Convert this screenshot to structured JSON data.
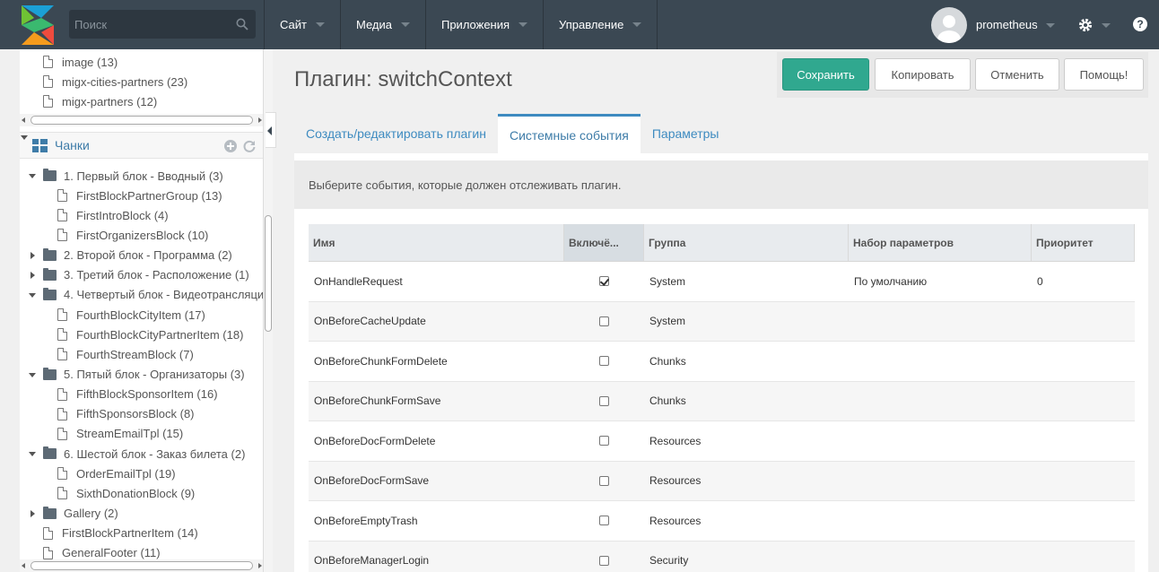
{
  "topbar": {
    "search_placeholder": "Поиск",
    "menu": [
      "Сайт",
      "Медиа",
      "Приложения",
      "Управление"
    ],
    "username": "prometheus",
    "help_label": "?"
  },
  "tree": {
    "top_files": [
      {
        "name": "image",
        "count": "(13)"
      },
      {
        "name": "migx-cities-partners",
        "count": "(23)"
      },
      {
        "name": "migx-partners",
        "count": "(12)"
      }
    ],
    "section_title": "Чанки",
    "items": [
      {
        "type": "folder",
        "open": true,
        "name": "1. Первый блок - Вводный",
        "count": "(3)"
      },
      {
        "type": "file",
        "name": "FirstBlockPartnerGroup",
        "count": "(13)"
      },
      {
        "type": "file",
        "name": "FirstIntroBlock",
        "count": "(4)"
      },
      {
        "type": "file",
        "name": "FirstOrganizersBlock",
        "count": "(10)"
      },
      {
        "type": "folder",
        "open": false,
        "name": "2. Второй блок - Программа",
        "count": "(2)"
      },
      {
        "type": "folder",
        "open": false,
        "name": "3. Третий блок - Расположение",
        "count": "(1)"
      },
      {
        "type": "folder",
        "open": true,
        "name": "4. Четвертый блок - Видеотрансляци",
        "count": ""
      },
      {
        "type": "file",
        "name": "FourthBlockCityItem",
        "count": "(17)"
      },
      {
        "type": "file",
        "name": "FourthBlockCityPartnerItem",
        "count": "(18)"
      },
      {
        "type": "file",
        "name": "FourthStreamBlock",
        "count": "(7)"
      },
      {
        "type": "folder",
        "open": true,
        "name": "5. Пятый блок - Организаторы",
        "count": "(3)"
      },
      {
        "type": "file",
        "name": "FifthBlockSponsorItem",
        "count": "(16)"
      },
      {
        "type": "file",
        "name": "FifthSponsorsBlock",
        "count": "(8)"
      },
      {
        "type": "file",
        "name": "StreamEmailTpl",
        "count": "(15)"
      },
      {
        "type": "folder",
        "open": true,
        "name": "6. Шестой блок - Заказ билета",
        "count": "(2)"
      },
      {
        "type": "file",
        "name": "OrderEmailTpl",
        "count": "(19)"
      },
      {
        "type": "file",
        "name": "SixthDonationBlock",
        "count": "(9)"
      },
      {
        "type": "folder",
        "open": false,
        "name": "Gallery",
        "count": "(2)"
      },
      {
        "type": "rootfile",
        "name": "FirstBlockPartnerItem",
        "count": "(14)"
      },
      {
        "type": "rootfile",
        "name": "GeneralFooter",
        "count": "(11)"
      }
    ]
  },
  "page": {
    "title": "Плагин: switchContext",
    "buttons": {
      "save": "Сохранить",
      "copy": "Копировать",
      "cancel": "Отменить",
      "help": "Помощь!"
    },
    "tabs": [
      "Создать/редактировать плагин",
      "Системные события",
      "Параметры"
    ],
    "description": "Выберите события, которые должен отслеживать плагин."
  },
  "grid": {
    "columns": [
      "Имя",
      "Включё...",
      "Группа",
      "Набор параметров",
      "Приоритет"
    ],
    "rows": [
      {
        "name": "OnHandleRequest",
        "enabled": true,
        "group": "System",
        "propset": "По умолчанию",
        "priority": "0"
      },
      {
        "name": "OnBeforeCacheUpdate",
        "enabled": false,
        "group": "System",
        "propset": "",
        "priority": ""
      },
      {
        "name": "OnBeforeChunkFormDelete",
        "enabled": false,
        "group": "Chunks",
        "propset": "",
        "priority": ""
      },
      {
        "name": "OnBeforeChunkFormSave",
        "enabled": false,
        "group": "Chunks",
        "propset": "",
        "priority": ""
      },
      {
        "name": "OnBeforeDocFormDelete",
        "enabled": false,
        "group": "Resources",
        "propset": "",
        "priority": ""
      },
      {
        "name": "OnBeforeDocFormSave",
        "enabled": false,
        "group": "Resources",
        "propset": "",
        "priority": ""
      },
      {
        "name": "OnBeforeEmptyTrash",
        "enabled": false,
        "group": "Resources",
        "propset": "",
        "priority": ""
      },
      {
        "name": "OnBeforeManagerLogin",
        "enabled": false,
        "group": "Security",
        "propset": "",
        "priority": ""
      }
    ]
  },
  "colors": {
    "topbar": "#3b4853",
    "primary": "#30a88f",
    "link": "#3e8bc0"
  }
}
